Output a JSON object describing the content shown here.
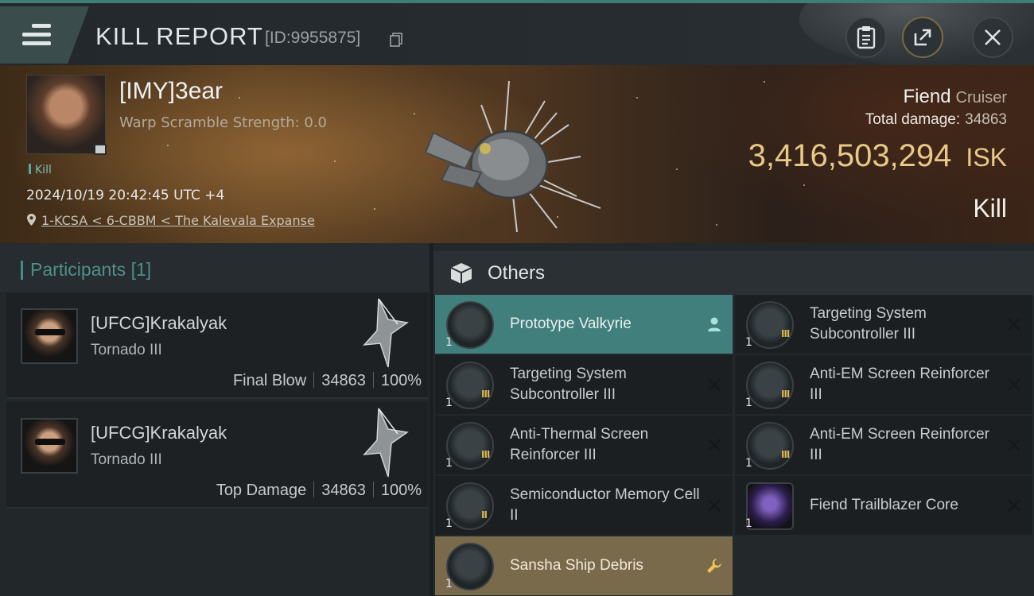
{
  "header": {
    "title": "KILL REPORT",
    "kill_id": "[ID:9955875]",
    "buttons": [
      "clipboard-icon",
      "share-icon",
      "close-icon"
    ]
  },
  "victim": {
    "name": "[IMY]3ear",
    "warp_scramble": "Warp Scramble Strength: 0.0",
    "tag": "Kill",
    "datetime": "2024/10/19 20:42:45 UTC +4",
    "location": "1-KCSA < 6-CBBM < The Kalevala Expanse",
    "ship_name": "Fiend",
    "ship_class": "Cruiser",
    "total_damage_label": "Total damage:",
    "total_damage": "34863",
    "isk_value": "3,416,503,294",
    "isk_unit": "ISK",
    "result": "Kill"
  },
  "participants": {
    "title": "Participants",
    "count": "[1]",
    "rows": [
      {
        "name": "[UFCG]Krakalyak",
        "ship": "Tornado III",
        "role": "Final Blow",
        "damage": "34863",
        "percent": "100%"
      },
      {
        "name": "[UFCG]Krakalyak",
        "ship": "Tornado III",
        "role": "Top Damage",
        "damage": "34863",
        "percent": "100%"
      }
    ]
  },
  "others": {
    "title": "Others",
    "items": [
      {
        "name": "Prototype  Valkyrie",
        "qty": "1",
        "tier": "",
        "state": "blue",
        "action": "person-icon"
      },
      {
        "name": "Targeting System Subcontroller III",
        "qty": "1",
        "tier": "III",
        "state": "dark",
        "action": "close-icon"
      },
      {
        "name": "Targeting System Subcontroller III",
        "qty": "1",
        "tier": "III",
        "state": "dark",
        "action": "close-icon"
      },
      {
        "name": "Anti-EM Screen Reinforcer III",
        "qty": "1",
        "tier": "III",
        "state": "dark",
        "action": "close-icon"
      },
      {
        "name": "Anti-Thermal Screen Reinforcer III",
        "qty": "1",
        "tier": "III",
        "state": "dark",
        "action": "close-icon"
      },
      {
        "name": "Anti-EM Screen Reinforcer III",
        "qty": "1",
        "tier": "III",
        "state": "dark",
        "action": "close-icon"
      },
      {
        "name": "Semiconductor Memory Cell II",
        "qty": "1",
        "tier": "II",
        "state": "dark",
        "action": "close-icon"
      },
      {
        "name": "Fiend Trailblazer Core",
        "qty": "1",
        "tier": "",
        "state": "dark",
        "action": "close-icon"
      },
      {
        "name": "Sansha Ship Debris",
        "qty": "1",
        "tier": "",
        "state": "gold",
        "action": "wrench-icon"
      }
    ]
  },
  "colors": {
    "accent_teal": "#417f7c",
    "isk_gold": "#e9c987",
    "loot_gold": "#7a6a4c"
  }
}
